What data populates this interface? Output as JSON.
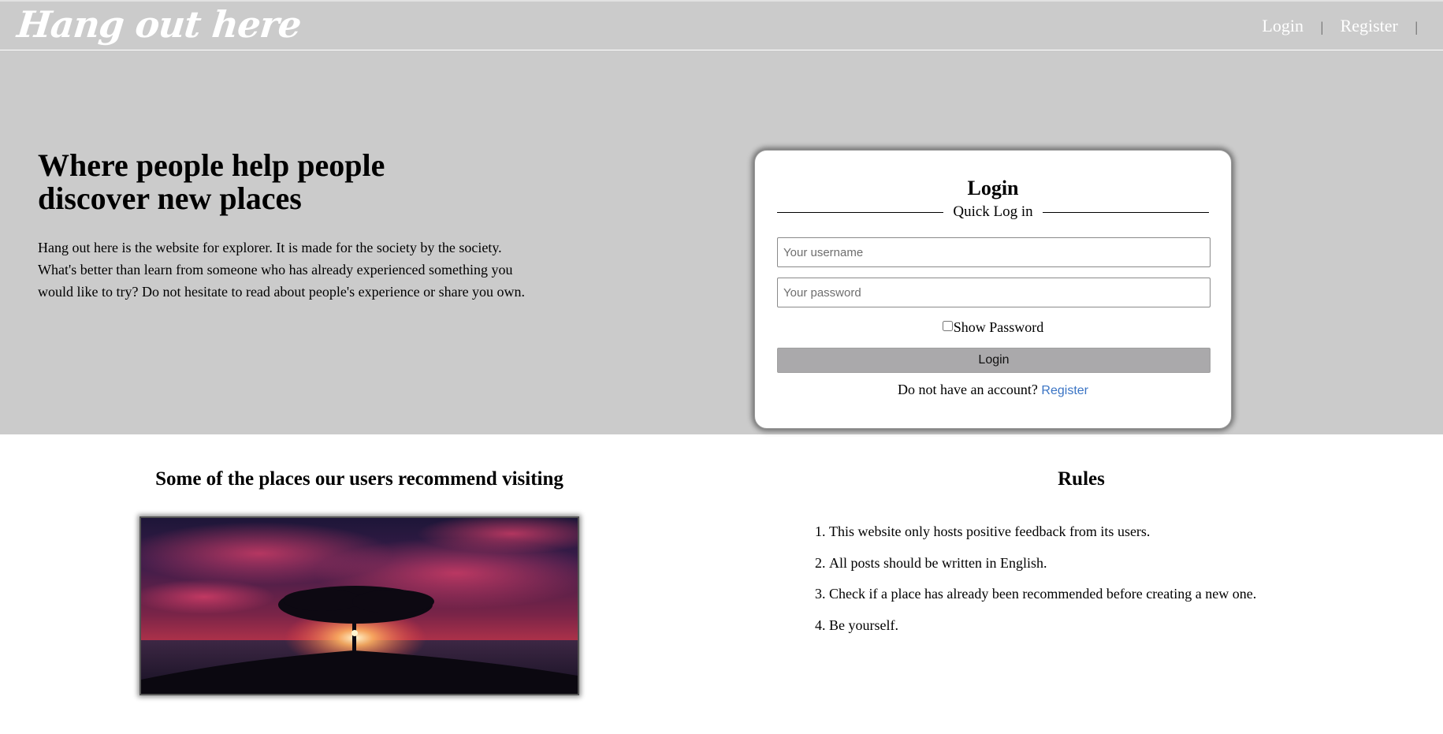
{
  "header": {
    "logo": "Hang out here",
    "nav": {
      "login": "Login",
      "separator": "|",
      "register": "Register"
    }
  },
  "hero": {
    "title": "Where people help people discover new places",
    "description": "Hang out here is the website for explorer. It is made for the society by the society. What's better than learn from someone who has already experienced something you would like to try? Do not hesitate to read about people's experience or share you own."
  },
  "login_form": {
    "title": "Login",
    "subtitle": "Quick Log in",
    "username_placeholder": "Your username",
    "password_placeholder": "Your password",
    "show_password_label": "Show Password",
    "show_password_checked": false,
    "submit_label": "Login",
    "no_account_text": "Do not have an account?",
    "register_link": "Register"
  },
  "places": {
    "title": "Some of the places our users recommend visiting",
    "image_description": "sunset-tree-by-sea-photo"
  },
  "rules": {
    "title": "Rules",
    "items": [
      "This website only hosts positive feedback from its users.",
      "All posts should be written in English.",
      "Check if a place has already been recommended before creating a new one.",
      "Be yourself."
    ]
  },
  "colors": {
    "header_bg": "#cbcbcb",
    "header_text": "#ffffff",
    "button_bg": "#aaa9ab",
    "link": "#3a74c4"
  }
}
